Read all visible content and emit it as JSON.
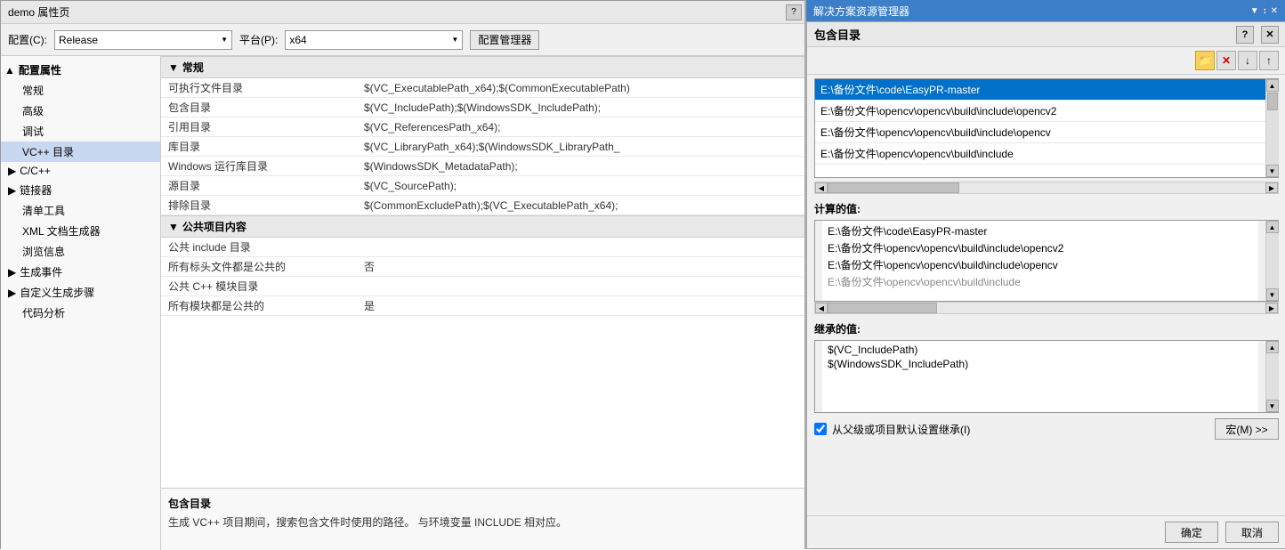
{
  "mainWindow": {
    "title": "demo 属性页"
  },
  "configBar": {
    "configLabel": "配置(C):",
    "configValue": "Release",
    "platformLabel": "平台(P):",
    "platformValue": "x64",
    "managerBtn": "配置管理器"
  },
  "sidebar": {
    "rootLabel": "▲ 配置属性",
    "items": [
      {
        "label": "常规",
        "active": false
      },
      {
        "label": "高级",
        "active": false
      },
      {
        "label": "调试",
        "active": false
      },
      {
        "label": "VC++ 目录",
        "active": true
      },
      {
        "label": "C/C++",
        "active": false,
        "expand": "▶"
      },
      {
        "label": "链接器",
        "active": false,
        "expand": "▶"
      },
      {
        "label": "清单工具",
        "active": false
      },
      {
        "label": "XML 文档生成器",
        "active": false
      },
      {
        "label": "浏览信息",
        "active": false
      },
      {
        "label": "生成事件",
        "active": false,
        "expand": "▶"
      },
      {
        "label": "自定义生成步骤",
        "active": false,
        "expand": "▶"
      },
      {
        "label": "代码分析",
        "active": false
      }
    ]
  },
  "sections": {
    "general": {
      "header": "常规",
      "rows": [
        {
          "name": "可执行文件目录",
          "value": "$(VC_ExecutablePath_x64);$(CommonExecutablePath)"
        },
        {
          "name": "包含目录",
          "value": "$(VC_IncludePath);$(WindowsSDK_IncludePath);"
        },
        {
          "name": "引用目录",
          "value": "$(VC_ReferencesPath_x64);"
        },
        {
          "name": "库目录",
          "value": "$(VC_LibraryPath_x64);$(WindowsSDK_LibraryPath_"
        },
        {
          "name": "Windows 运行库目录",
          "value": "$(WindowsSDK_MetadataPath);"
        },
        {
          "name": "源目录",
          "value": "$(VC_SourcePath);"
        },
        {
          "name": "排除目录",
          "value": "$(CommonExcludePath);$(VC_ExecutablePath_x64);"
        }
      ]
    },
    "publicItems": {
      "header": "公共项目内容",
      "rows": [
        {
          "name": "公共 include 目录",
          "value": ""
        },
        {
          "name": "所有标头文件都是公共的",
          "value": "否"
        },
        {
          "name": "公共 C++ 模块目录",
          "value": ""
        },
        {
          "name": "所有模块都是公共的",
          "value": "是"
        }
      ]
    }
  },
  "description": {
    "title": "包含目录",
    "text": "生成 VC++ 项目期间，搜索包含文件时使用的路径。 与环境变量 INCLUDE 相对应。"
  },
  "sidePanel": {
    "title": "解决方案资源管理器"
  },
  "includeDialog": {
    "title": "包含目录",
    "toolbar": {
      "folderIcon": "📁",
      "deleteIcon": "✕",
      "downIcon": "↓",
      "upIcon": "↑"
    },
    "paths": [
      {
        "value": "E:\\备份文件\\code\\EasyPR-master",
        "selected": true
      },
      {
        "value": "E:\\备份文件\\opencv\\opencv\\build\\include\\opencv2",
        "selected": false
      },
      {
        "value": "E:\\备份文件\\opencv\\opencv\\build\\include\\opencv",
        "selected": false
      },
      {
        "value": "E:\\备份文件\\opencv\\opencv\\build\\include",
        "selected": false
      }
    ],
    "computedLabel": "计算的值:",
    "computedValues": [
      "E:\\备份文件\\code\\EasyPR-master",
      "E:\\备份文件\\opencv\\opencv\\build\\include\\opencv2",
      "E:\\备份文件\\opencv\\opencv\\build\\include\\opencv",
      "E:\\备份文件\\opencv\\opencv\\build\\include"
    ],
    "inheritedLabel": "继承的值:",
    "inheritedValues": [
      "$(VC_IncludePath)",
      "$(WindowsSDK_IncludePath)"
    ],
    "checkboxLabel": "从父级或项目默认设置继承(I)",
    "macroBtn": "宏(M) >>",
    "okBtn": "确定",
    "cancelBtn": "取消"
  }
}
